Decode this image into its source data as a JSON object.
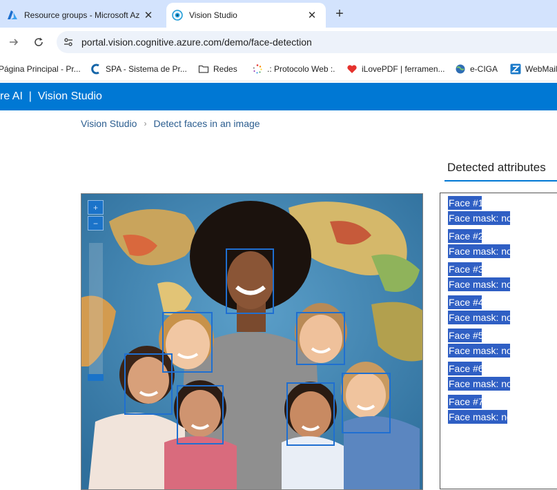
{
  "browser": {
    "tabs": [
      {
        "title": "Resource groups - Microsoft Az",
        "icon": "azure-icon",
        "active": false
      },
      {
        "title": "Vision Studio",
        "icon": "vision-studio-icon",
        "active": true
      }
    ],
    "url": "portal.vision.cognitive.azure.com/demo/face-detection",
    "bookmarks": [
      {
        "label": "Página Principal - Pr...",
        "icon": "none"
      },
      {
        "label": "SPA - Sistema de Pr...",
        "icon": "c-logo-icon"
      },
      {
        "label": "Redes",
        "icon": "folder-icon"
      },
      {
        "label": ".: Protocolo Web :.",
        "icon": "spinner-icon"
      },
      {
        "label": "iLovePDF | ferramen...",
        "icon": "heart-icon"
      },
      {
        "label": "e-CIGA",
        "icon": "globe-icon"
      },
      {
        "label": "WebMail",
        "icon": "z-logo-icon"
      }
    ]
  },
  "app": {
    "header": "re AI  |  Vision Studio",
    "breadcrumb": {
      "root": "Vision Studio",
      "current": "Detect faces in an image"
    }
  },
  "attributes": {
    "title": "Detected attributes",
    "faces": [
      {
        "name": "Face #1",
        "mask": "Face mask: no"
      },
      {
        "name": "Face #2",
        "mask": "Face mask: no"
      },
      {
        "name": "Face #3",
        "mask": "Face mask: no"
      },
      {
        "name": "Face #4",
        "mask": "Face mask: no"
      },
      {
        "name": "Face #5",
        "mask": "Face mask: no"
      },
      {
        "name": "Face #6",
        "mask": "Face mask: no"
      },
      {
        "name": "Face #7",
        "mask": "Face mask: no"
      }
    ]
  },
  "viewer": {
    "zoom_in_label": "+",
    "zoom_out_label": "−",
    "box_color": "#1f6fd1"
  },
  "colors": {
    "header_bg": "#0078d4",
    "selection_bg": "#2f5fc4",
    "tab_strip_bg": "#d3e3fd"
  }
}
